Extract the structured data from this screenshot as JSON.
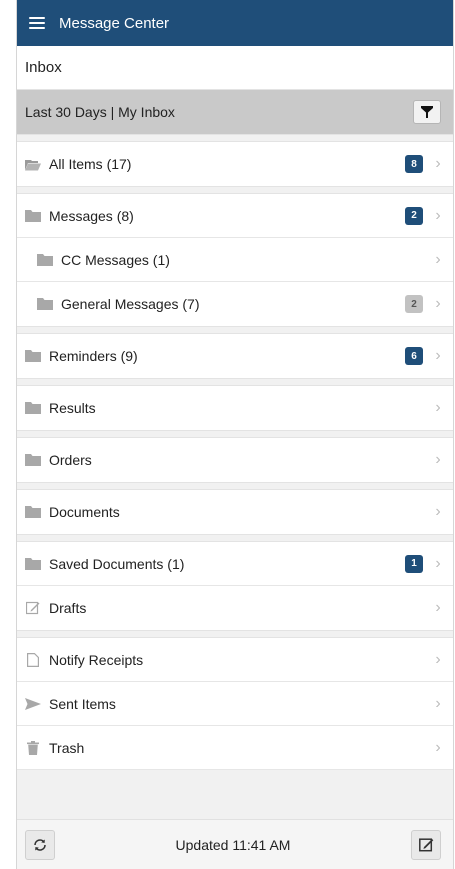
{
  "header": {
    "title": "Message Center",
    "menu_icon": "hamburger-icon"
  },
  "inbox": {
    "title": "Inbox"
  },
  "filter": {
    "label": "Last 30 Days | My Inbox",
    "icon": "filter-icon"
  },
  "folders": {
    "all_items": {
      "label": "All Items (17)",
      "badge": "8",
      "icon": "folder-open-icon"
    },
    "messages": {
      "label": "Messages (8)",
      "badge": "2",
      "icon": "folder-icon"
    },
    "cc_messages": {
      "label": "CC Messages (1)",
      "icon": "folder-icon"
    },
    "general_messages": {
      "label": "General Messages (7)",
      "badge": "2",
      "icon": "folder-icon"
    },
    "reminders": {
      "label": "Reminders (9)",
      "badge": "6",
      "icon": "folder-icon"
    },
    "results": {
      "label": "Results",
      "icon": "folder-icon"
    },
    "orders": {
      "label": "Orders",
      "icon": "folder-icon"
    },
    "documents": {
      "label": "Documents",
      "icon": "folder-icon"
    },
    "saved_documents": {
      "label": "Saved Documents (1)",
      "badge": "1",
      "icon": "folder-icon"
    },
    "drafts": {
      "label": "Drafts",
      "icon": "pencil-square-icon"
    },
    "notify_receipts": {
      "label": "Notify Receipts",
      "icon": "document-icon"
    },
    "sent_items": {
      "label": "Sent Items",
      "icon": "send-icon"
    },
    "trash": {
      "label": "Trash",
      "icon": "trash-icon"
    }
  },
  "footer": {
    "updated": "Updated 11:41 AM",
    "refresh_icon": "refresh-icon",
    "compose_icon": "compose-icon"
  },
  "colors": {
    "header": "#1f4e79",
    "badge_blue": "#1f4e79",
    "badge_gray": "#c2c2c2",
    "filter_bar": "#c9c9c9"
  }
}
